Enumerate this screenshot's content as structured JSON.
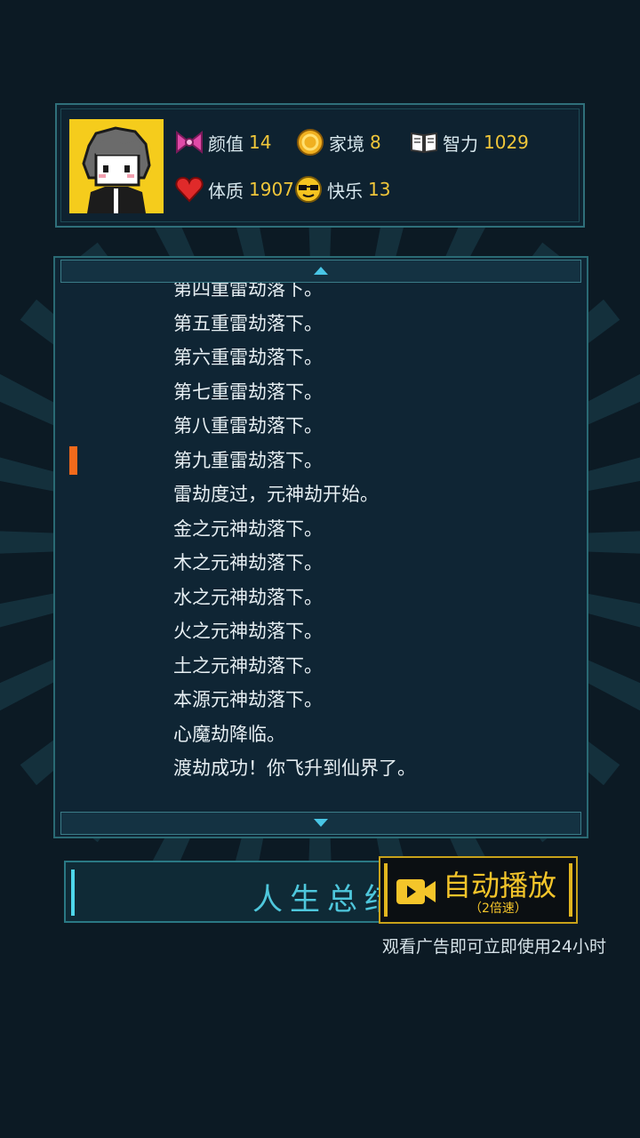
{
  "stats": {
    "looks_label": "颜值",
    "looks_value": "14",
    "family_label": "家境",
    "family_value": "8",
    "intellect_label": "智力",
    "intellect_value": "1029",
    "physique_label": "体质",
    "physique_value": "1907",
    "happiness_label": "快乐",
    "happiness_value": "13"
  },
  "log_lines": [
    "第四重雷劫落下。",
    "第五重雷劫落下。",
    "第六重雷劫落下。",
    "第七重雷劫落下。",
    "第八重雷劫落下。",
    "第九重雷劫落下。",
    "雷劫度过，元神劫开始。",
    "金之元神劫落下。",
    "木之元神劫落下。",
    "水之元神劫落下。",
    "火之元神劫落下。",
    "土之元神劫落下。",
    "本源元神劫落下。",
    "心魔劫降临。",
    "渡劫成功！你飞升到仙界了。"
  ],
  "buttons": {
    "summary_label": "人生总结",
    "auto_play_label": "自动播放",
    "auto_play_speed": "（2倍速）"
  },
  "ad_note": "观看广告即可立即使用24小时",
  "icons": {
    "looks": "bow-icon",
    "family": "coin-icon",
    "intellect": "book-icon",
    "physique": "heart-icon",
    "happiness": "sunglasses-face-icon",
    "auto_play": "video-camera-icon"
  },
  "colors": {
    "accent": "#49c6e6",
    "gold": "#f4c52a",
    "marker": "#f26a1b",
    "background": "#0c1a24"
  }
}
